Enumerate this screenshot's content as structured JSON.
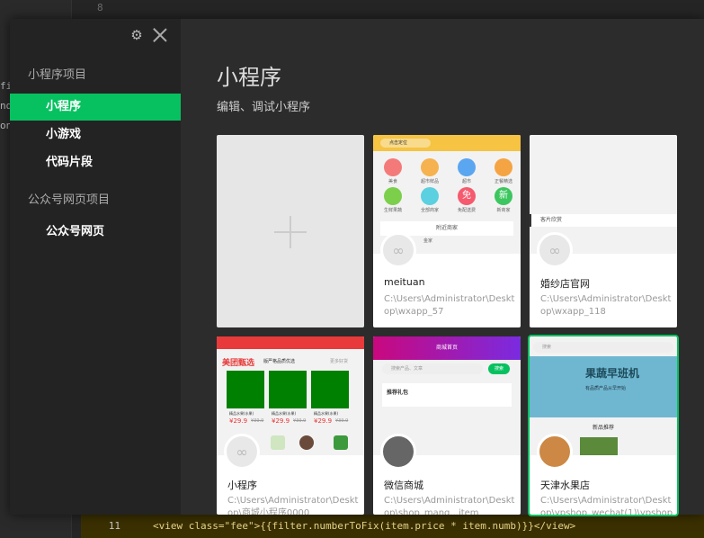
{
  "editor": {
    "top_line_no": "8",
    "left_fragments": [
      "fi",
      "nd",
      "on"
    ],
    "bottom_lines": [
      {
        "ln": "11",
        "code": "<view class=\"fee\">{{filter.numberToFix(item.price * item.numb)}}</view>"
      }
    ]
  },
  "sidebar": {
    "section1_title": "小程序项目",
    "items1": [
      {
        "label": "小程序"
      },
      {
        "label": "小游戏"
      },
      {
        "label": "代码片段"
      }
    ],
    "section2_title": "公众号网页项目",
    "items2": [
      {
        "label": "公众号网页"
      }
    ]
  },
  "main": {
    "title": "小程序",
    "subtitle": "编辑、调试小程序"
  },
  "cards": [
    {
      "name": "meituan",
      "path": "C:\\Users\\Administrator\\Desktop\\wxapp_57"
    },
    {
      "name": "婚纱店官网",
      "path": "C:\\Users\\Administrator\\Desktop\\wxapp_118"
    },
    {
      "name": "小程序",
      "path": "C:\\Users\\Administrator\\Desktop\\商城小程序0000"
    },
    {
      "name": "微信商城",
      "path": "C:\\Users\\Administrator\\Desktop\\shop_mang...item"
    },
    {
      "name": "天津水果店",
      "path": "C:\\Users\\Administrator\\Desktop\\ypshop_wechat(1)\\ypshop_wec..."
    }
  ],
  "thumbs": {
    "meituan": {
      "location": "点击定位",
      "icons": [
        "美食",
        "超市鲜品",
        "超市",
        "正餐精选",
        "生鲜果蔬",
        "全部商家",
        "免配送费",
        "新商家"
      ],
      "free_label": "免",
      "new_label": "新",
      "nearby": "附近商家",
      "shop": "金家"
    },
    "wedding": {
      "text": "客片欣赏"
    },
    "mall": {
      "brand": "美团甄选",
      "tab": "版严格品质优选",
      "more": "更多好货",
      "item_label": "精品水果(水果)",
      "price": "¥29.9",
      "old_price": "¥39.9"
    },
    "wechat_mall": {
      "header": "商城首页",
      "search": "搜索产品、文章",
      "search_btn": "搜索",
      "section": "推荐礼包"
    },
    "fruit": {
      "search": "搜索",
      "banner_title": "果蔬早班机",
      "banner_sub": "有品质产品从早开始",
      "rec": "新品推荐"
    }
  },
  "colors": {
    "accent": "#07c160",
    "sidebar_bg": "#232323",
    "main_bg": "#2c2c2c"
  },
  "icons": {
    "gear": "gear-icon",
    "close": "close-icon",
    "plus": "plus-icon",
    "mini_program_logo": "mini-program-logo-icon"
  }
}
